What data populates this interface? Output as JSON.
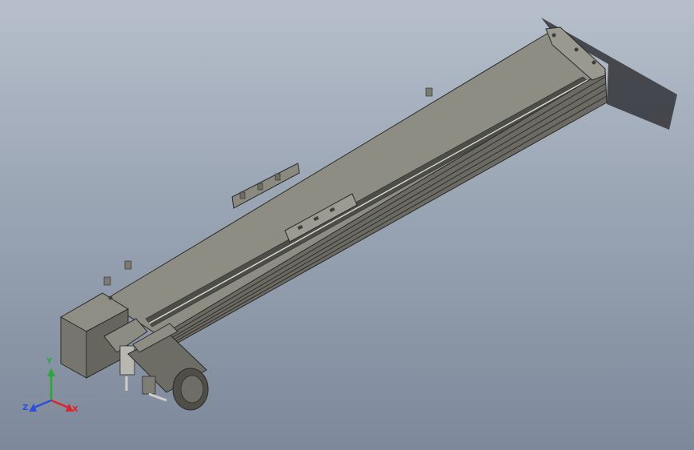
{
  "viewport": {
    "background_top": "#b6bfcb",
    "background_bottom": "#7d889a"
  },
  "model": {
    "body_color": "#8f8f86",
    "dark_color": "#3e3e3a"
  },
  "triad": {
    "x_label": "X",
    "y_label": "Y",
    "z_label": "Z",
    "x_color": "#d8262c",
    "y_color": "#2aa83a",
    "z_color": "#2b4fd8"
  }
}
